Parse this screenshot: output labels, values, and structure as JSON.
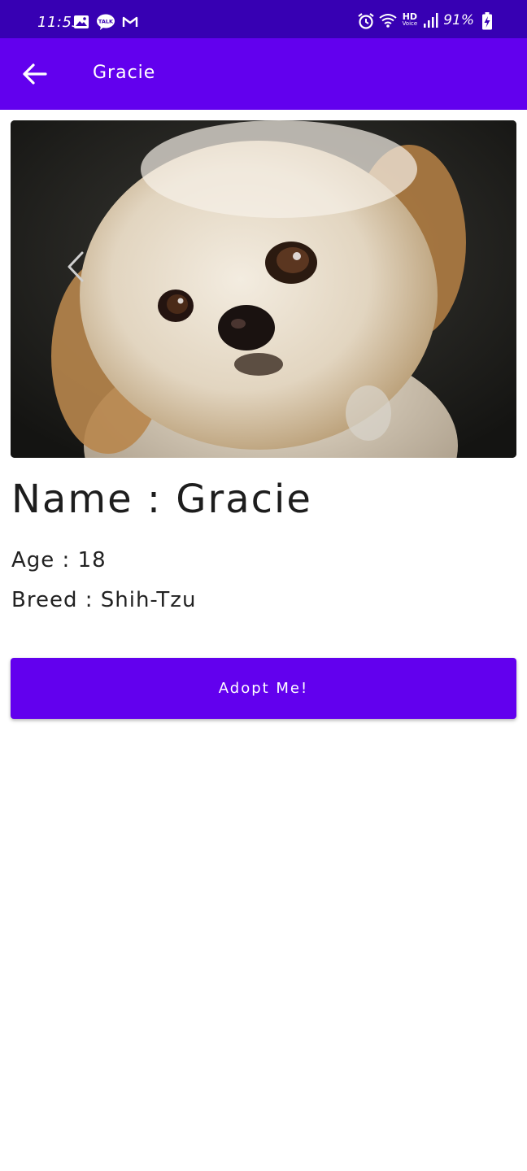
{
  "status_bar": {
    "time": "11:53",
    "battery_percent": "91%",
    "hd_label": "HD",
    "voice_label": "Voice",
    "left_icons": [
      "image-icon",
      "kakaotalk-icon",
      "gmail-icon"
    ],
    "kakao_label": "TALK",
    "right_icons": [
      "alarm-icon",
      "wifi-icon",
      "signal-icon",
      "battery-charging-icon"
    ],
    "background": "#3700b3"
  },
  "app_bar": {
    "title": "Gracie",
    "back_icon": "arrow-left-icon",
    "background": "#6200ee"
  },
  "photo": {
    "subject": "shih-tzu-dog-photo",
    "prev_icon": "chevron-left-icon"
  },
  "pet": {
    "name_line": "Name : Gracie",
    "age_line": "Age : 18",
    "breed_line": "Breed : Shih-Tzu"
  },
  "adopt_button": {
    "label": "Adopt Me!",
    "color": "#6200ee"
  }
}
